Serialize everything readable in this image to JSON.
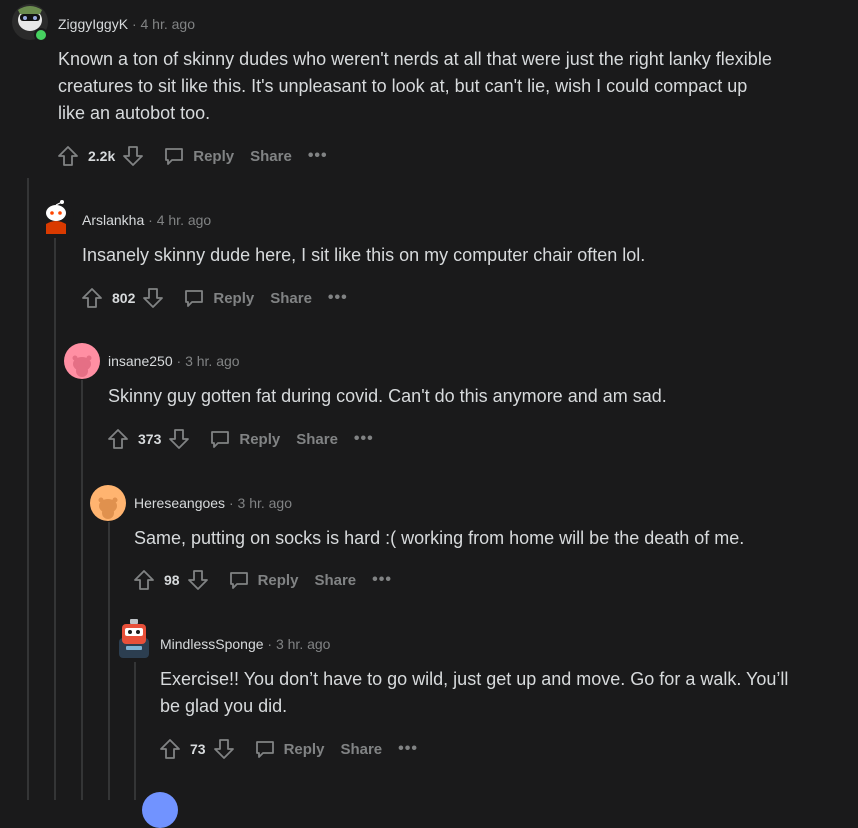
{
  "actions": {
    "reply_label": "Reply",
    "share_label": "Share",
    "more_label": "•••"
  },
  "separator": "·",
  "comments": [
    {
      "username": "ZiggyIggyK",
      "timestamp": "4 hr. ago",
      "body": "Known a ton of skinny dudes who weren't nerds at all that were just the right lanky flexible\ncreatures to sit like this. It's unpleasant to look at, but can't lie, wish I could compact up\nlike an autobot too.",
      "votes": "2.2k",
      "online": true
    },
    {
      "username": "Arslankha",
      "timestamp": "4 hr. ago",
      "body": "Insanely skinny dude here, I sit like this on my computer chair often lol.",
      "votes": "802"
    },
    {
      "username": "insane250",
      "timestamp": "3 hr. ago",
      "body": "Skinny guy gotten fat during covid. Can't do this anymore and am sad.",
      "votes": "373"
    },
    {
      "username": "Hereseangoes",
      "timestamp": "3 hr. ago",
      "body": "Same, putting on socks is hard :( working from home will be the death of me.",
      "votes": "98"
    },
    {
      "username": "MindlessSponge",
      "timestamp": "3 hr. ago",
      "body": "Exercise!! You don’t have to go wild, just get up and move. Go for a walk. You’ll\nbe glad you did.",
      "votes": "73"
    }
  ],
  "colors": {
    "background": "#1a1a1b",
    "text": "#d7dadc",
    "muted": "#818384",
    "thread_line": "#343536",
    "online": "#46d160"
  }
}
